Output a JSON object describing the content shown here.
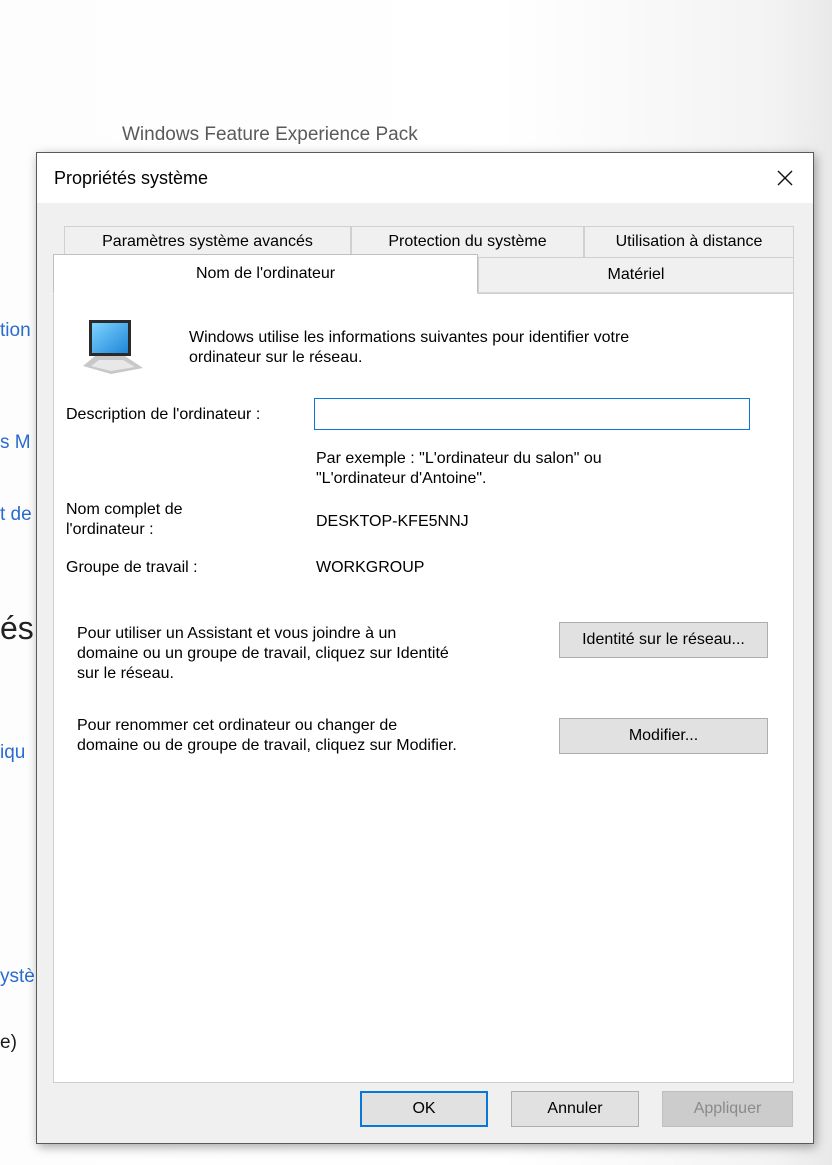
{
  "background": {
    "header": "Windows Feature Experience Pack",
    "links": [
      "tion",
      "s M",
      "t de",
      "iqu",
      "ystè",
      "e)"
    ],
    "heading": "és"
  },
  "dialog": {
    "title": "Propriétés système",
    "tabs_row1": [
      "Paramètres système avancés",
      "Protection du système",
      "Utilisation à distance"
    ],
    "tabs_row2": [
      "Nom de l'ordinateur",
      "Matériel"
    ],
    "active_tab": "Nom de l'ordinateur",
    "intro_line1": "Windows utilise les informations suivantes pour identifier votre",
    "intro_line2": "ordinateur sur le réseau.",
    "description_label": "Description de l'ordinateur :",
    "description_value": "",
    "example_line1": "Par exemple : \"L'ordinateur du salon\" ou",
    "example_line2": "\"L'ordinateur d'Antoine\".",
    "fullname_label_line1": "Nom complet de",
    "fullname_label_line2": "l'ordinateur :",
    "fullname_value": "DESKTOP-KFE5NNJ",
    "workgroup_label": "Groupe de travail :",
    "workgroup_value": "WORKGROUP",
    "network_text_line1": "Pour utiliser un Assistant et vous joindre à un",
    "network_text_line2": "domaine ou un groupe de travail, cliquez sur Identité",
    "network_text_line3": "sur le réseau.",
    "network_button": "Identité sur le réseau...",
    "rename_text_line1": "Pour renommer cet ordinateur ou changer de",
    "rename_text_line2": "domaine ou de groupe de travail, cliquez sur Modifier.",
    "rename_button": "Modifier...",
    "ok_button": "OK",
    "cancel_button": "Annuler",
    "apply_button": "Appliquer"
  }
}
